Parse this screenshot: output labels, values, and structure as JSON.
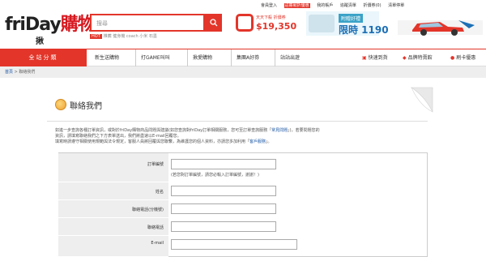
{
  "header": {
    "logo_main": "friDay",
    "logo_cjk": "購物",
    "logo_sub": "揪",
    "search_placeholder": "搜尋",
    "hot_tag": "HOT",
    "hot_terms": "推薦 健身機 coach 小米 石墨",
    "top_nav": [
      "會員登入",
      "註冊就折優惠",
      "我的帳戶",
      "追蹤清單",
      "折價券(0)",
      "清單停單"
    ],
    "ad1_label": "天天下殺 折價券",
    "ad1_price": "$19,350",
    "ad2_tag": "附贈好禮",
    "ad2_price": "限時 1190"
  },
  "nav": {
    "all_categories": "全站分類",
    "items": [
      "新生送購物",
      "打GAME叫叫",
      "揪愛購物",
      "集團A好券",
      "站站出遊"
    ],
    "right_items": [
      "快速到貨",
      "品牌特賣館",
      "刷卡優惠"
    ]
  },
  "breadcrumb": {
    "home": "首頁",
    "current": "聯絡我們"
  },
  "page": {
    "title": "聯絡我們",
    "para_line1_a": "如進一步查詢各種訂單資訊，或對於friDay購物商品問題與建議(如您查詢對friDay訂單相關服務，您可至訂單查詢服務「",
    "para_line1_link": "常見問題",
    "para_line1_b": "」)，若要問題您的",
    "para_line2": "資訊，請填寫聯絡我們之下方表單送出，我們將盡速以E-mail回覆您。",
    "para_line3_a": "填寫時請遵守相關使用規範與法令規定，客服人員將回覆與您聯繫，為維護您的個人資料，亦請您多加利用「",
    "para_line3_link": "客戶服務",
    "para_line3_b": "」。"
  },
  "form": {
    "order_label": "訂單編號",
    "order_hint": "(若您對訂單編號，請您必輸入訂單編號，謝謝！)",
    "name_label": "姓名",
    "phone_label": "聯絡電話(分機號)",
    "mobile_label": "聯絡電話",
    "email_label": "E-mail"
  },
  "colors": {
    "brand_red": "#e3352a",
    "link_blue": "#1a57a6"
  }
}
